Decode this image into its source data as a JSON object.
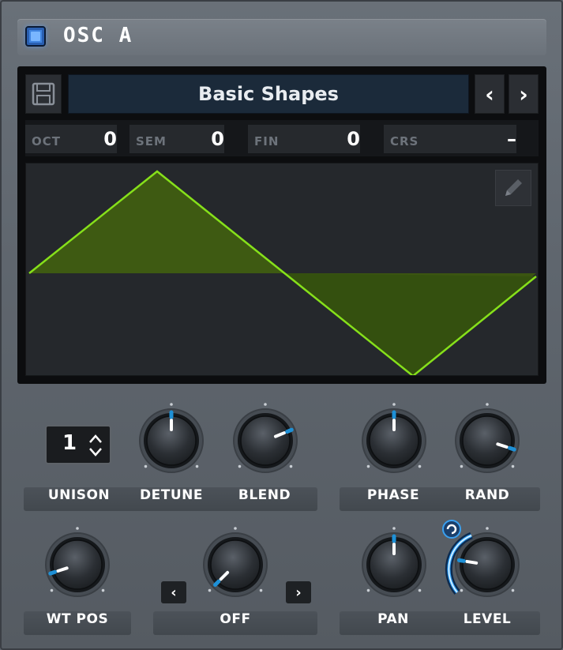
{
  "header": {
    "title": "OSC A",
    "enabled": true
  },
  "wavetable": {
    "name": "Basic Shapes",
    "prev_label": "‹",
    "next_label": "›",
    "save_icon": "save-icon",
    "edit_icon": "pencil-icon"
  },
  "tuning": [
    {
      "label": "OCT",
      "value": "0"
    },
    {
      "label": "SEM",
      "value": "0"
    },
    {
      "label": "FIN",
      "value": "0"
    },
    {
      "label": "CRS",
      "value": "–"
    }
  ],
  "unison": {
    "value": "1",
    "label": "UNISON"
  },
  "knobs": {
    "detune": {
      "label": "DETUNE",
      "value": 0.5
    },
    "blend": {
      "label": "BLEND",
      "value": 0.75
    },
    "phase": {
      "label": "PHASE",
      "value": 0.5
    },
    "rand": {
      "label": "RAND",
      "value": 0.9
    },
    "wt_pos": {
      "label": "WT POS",
      "value": 0.1
    },
    "warp": {
      "label": "OFF",
      "value": 0.0
    },
    "pan": {
      "label": "PAN",
      "value": 0.5
    },
    "level": {
      "label": "LEVEL",
      "value": 0.2
    }
  },
  "warp_prev_label": "‹",
  "warp_next_label": "›",
  "colors": {
    "accent": "#1e90d6",
    "wave_line": "#86e01a",
    "wave_fill": "#3e5a12",
    "toggle": "#3f84e0"
  }
}
